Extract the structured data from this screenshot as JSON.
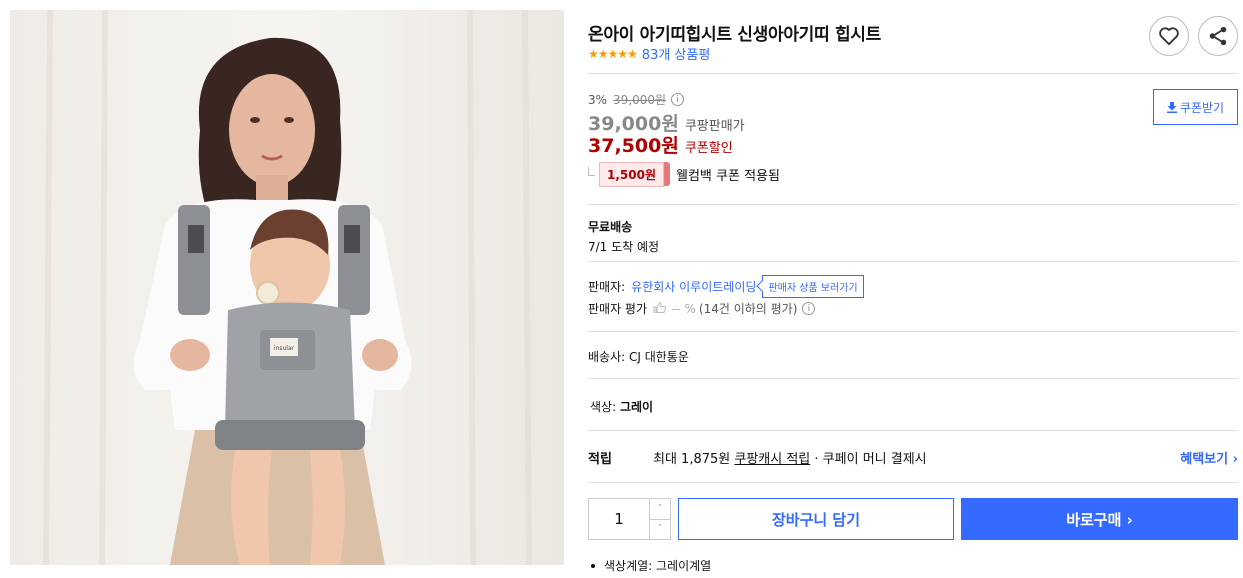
{
  "product": {
    "title": "온아이 아기띠힙시트 신생아아기띠 힙시트",
    "stars": "★★★★★",
    "review_count": "83개 상품평",
    "image_brand": "insular"
  },
  "price": {
    "discount_rate": "3%",
    "original_price": "39,000원",
    "sale_price": "39,000원",
    "sale_label": "쿠팡판매가",
    "coupon_price": "37,500원",
    "coupon_label": "쿠폰할인",
    "welcome_coupon_amount": "1,500원",
    "welcome_coupon_text": "웰컴백 쿠폰 적용됨",
    "coupon_download_label": "쿠폰받기"
  },
  "shipping": {
    "title": "무료배송",
    "eta": "7/1 도착 예정"
  },
  "seller": {
    "label": "판매자:",
    "name": "유한회사 이루이트레이딩",
    "view_products": "판매자 상품 보러가기",
    "rating_label": "판매자 평가",
    "rating_value": "-- %",
    "rating_count": "(14건 이하의 평가)"
  },
  "carrier": "배송사: CJ 대한통운",
  "option": {
    "label": "색상:",
    "value": "그레이"
  },
  "reward": {
    "label": "적립",
    "prefix": "최대 1,875원 ",
    "link": "쿠팡캐시 적립",
    "suffix": " · 쿠페이 머니 결제시",
    "benefit_link": "혜택보기 ›"
  },
  "purchase": {
    "quantity": "1",
    "cart_label": "장바구니 담기",
    "buy_label": "바로구매 ›"
  },
  "option_note": "색상계열: 그레이계열",
  "colors": {
    "accent": "#346aff",
    "price_red": "#ae0000",
    "star": "#f79d00"
  }
}
